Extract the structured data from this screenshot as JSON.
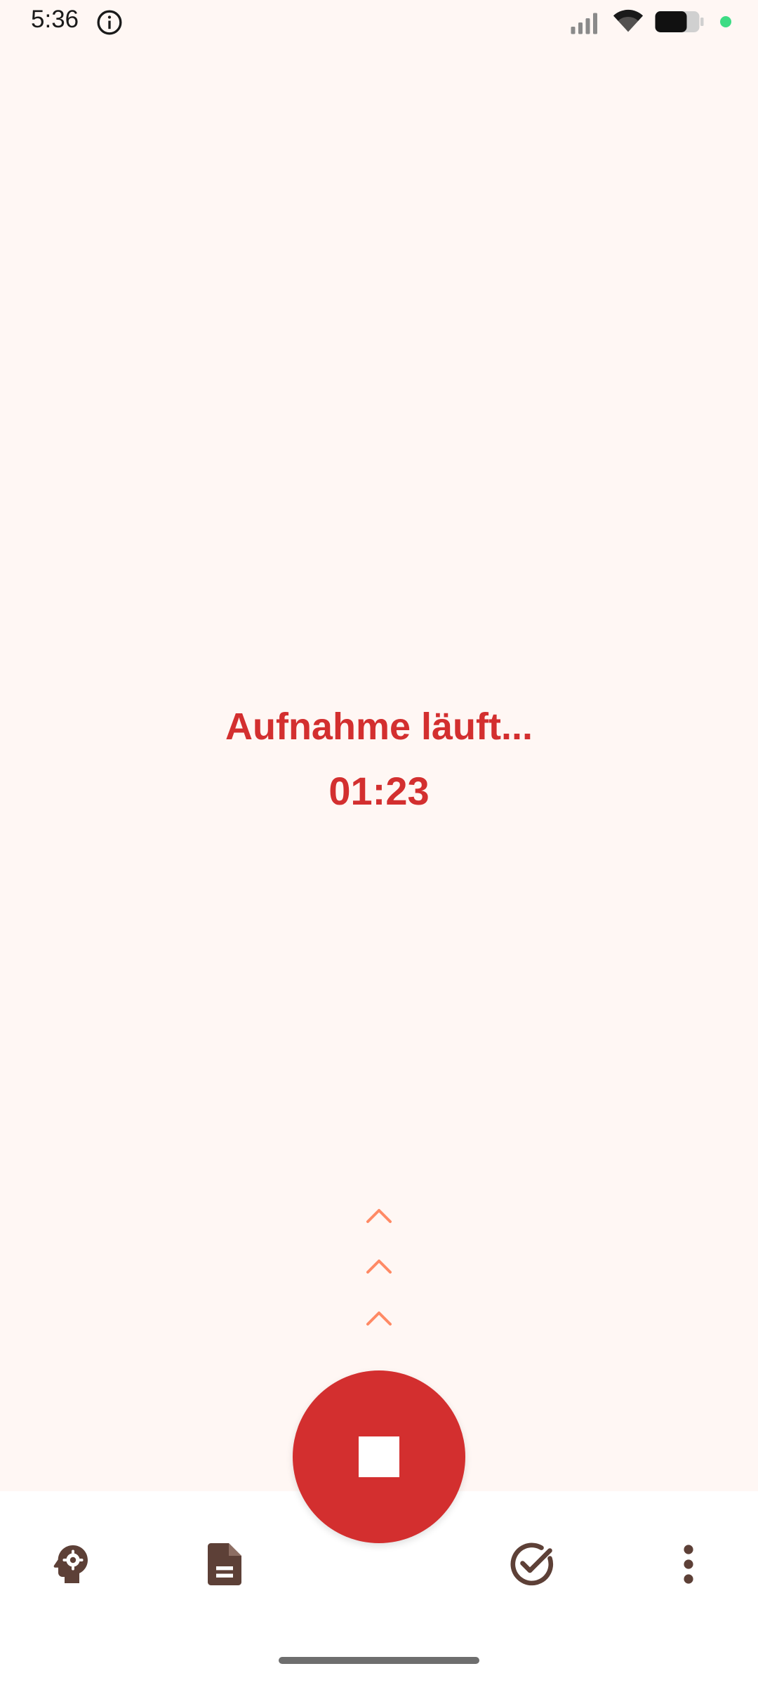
{
  "status_bar": {
    "time": "5:36",
    "icons": [
      "info-icon",
      "signal-icon",
      "wifi-icon",
      "battery-icon",
      "privacy-dot"
    ]
  },
  "recording": {
    "title": "Aufnahme läuft...",
    "elapsed": "01:23"
  },
  "swipe_hint": {
    "icon": "chevron-up-icon",
    "count": 3,
    "color": "#FF8A65"
  },
  "stop_button": {
    "icon": "stop-icon",
    "color": "#D32F2F"
  },
  "bottom_nav": {
    "items": [
      {
        "icon": "psychology-gear-icon"
      },
      {
        "icon": "document-icon"
      },
      {
        "icon": "check-circle-icon"
      },
      {
        "icon": "more-vert-icon"
      }
    ],
    "icon_color": "#5D4037"
  },
  "colors": {
    "background": "#FFF7F4",
    "accent": "#D32F2F",
    "status_dot": "#3DDC84"
  }
}
